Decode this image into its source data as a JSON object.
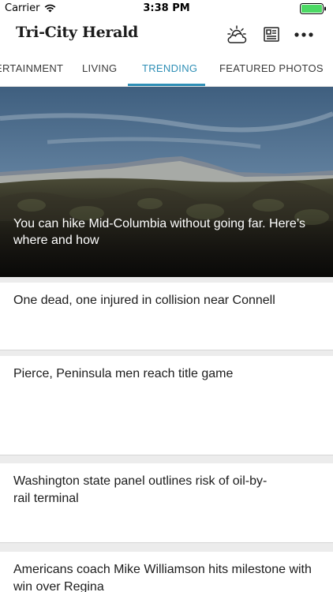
{
  "status_bar": {
    "carrier": "Carrier",
    "time": "3:38 PM",
    "wifi_icon": "wifi-icon",
    "battery_icon": "battery-icon",
    "battery_color": "#4cd964"
  },
  "header": {
    "logo_text": "Tri-City Herald",
    "icons": [
      "weather-icon",
      "newspaper-icon",
      "more-icon"
    ]
  },
  "tabs": {
    "items": [
      {
        "label": "ERTAINMENT"
      },
      {
        "label": "LIVING"
      },
      {
        "label": "TRENDING",
        "active": true
      },
      {
        "label": "FEATURED PHOTOS"
      }
    ],
    "accent_color": "#2f8fb6"
  },
  "hero": {
    "title": "You can hike Mid-Columbia without going far. Here’s where and how"
  },
  "articles": [
    {
      "title": "One dead, one injured in collision near Connell"
    },
    {
      "title": "Pierce, Peninsula men reach title game"
    },
    {
      "title": "Washington state panel outlines risk of oil-by-rail terminal"
    },
    {
      "title": "Americans coach Mike Williamson hits milestone with win over Regina"
    }
  ]
}
